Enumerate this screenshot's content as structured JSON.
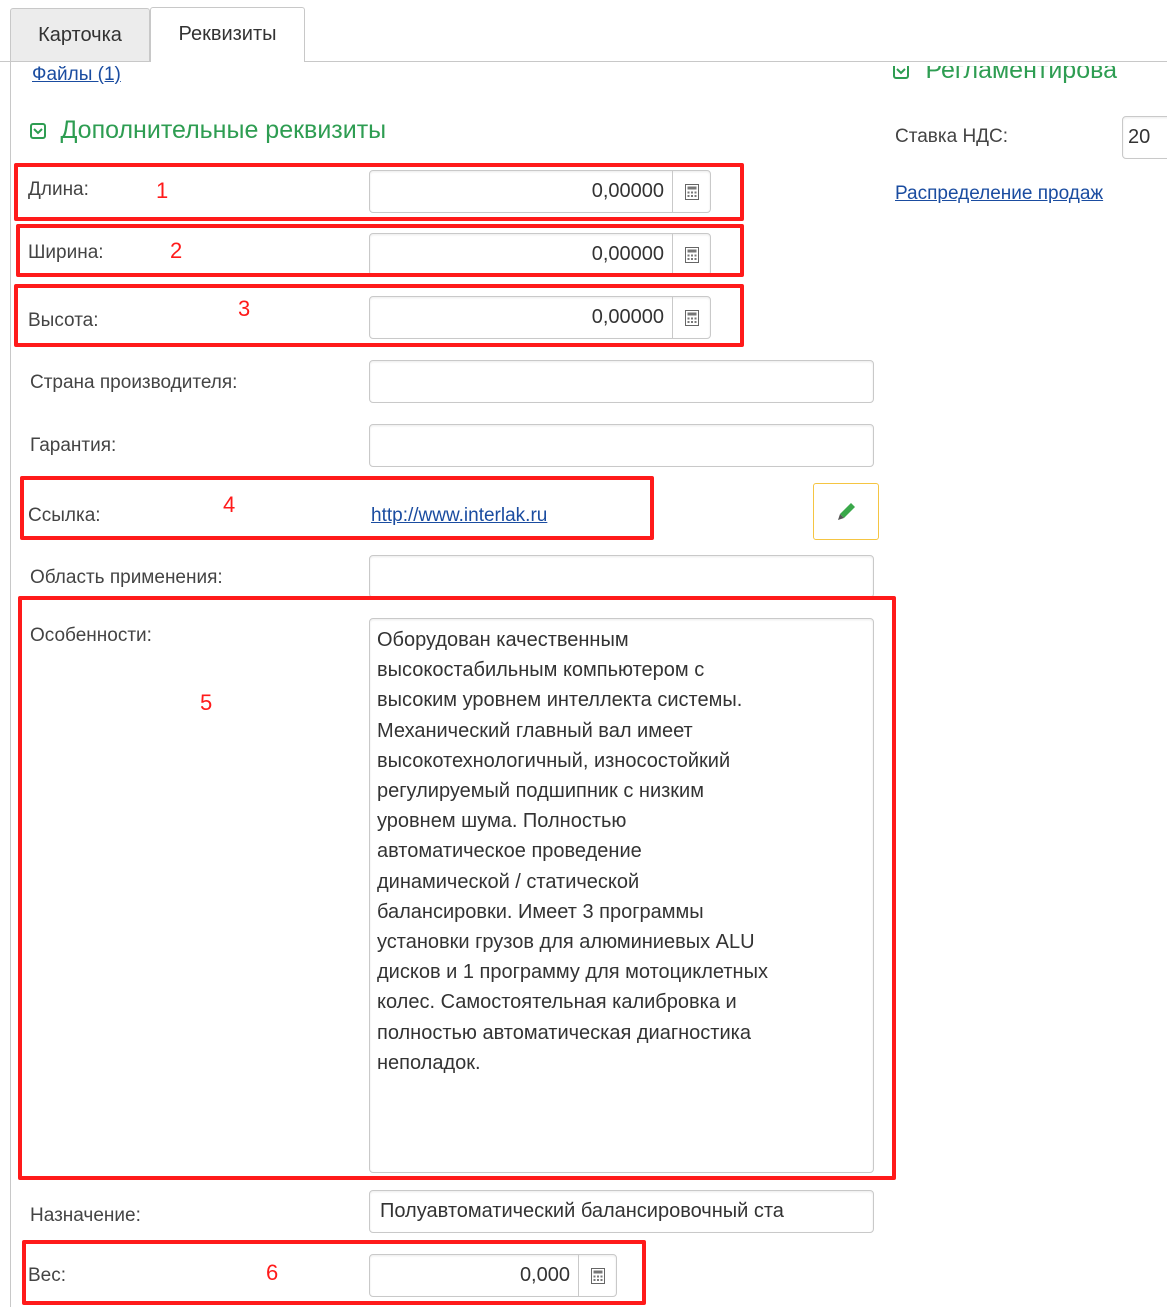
{
  "tabs": [
    {
      "label": "Карточка",
      "active": false
    },
    {
      "label": "Реквизиты",
      "active": true
    }
  ],
  "files_link": "Файлы (1)",
  "additional_section": {
    "title": "Дополнительные реквизиты"
  },
  "right_section": {
    "title": "Регламентирова",
    "vat_label": "Ставка НДС:",
    "vat_value": "20",
    "distribution_link": "Распределение продаж"
  },
  "fields": {
    "length": {
      "label": "Длина:",
      "value": "0,00000"
    },
    "width": {
      "label": "Ширина:",
      "value": "0,00000"
    },
    "height": {
      "label": "Высота:",
      "value": "0,00000"
    },
    "country": {
      "label": "Страна производителя:",
      "value": ""
    },
    "warranty": {
      "label": "Гарантия:",
      "value": ""
    },
    "link": {
      "label": "Ссылка:",
      "value": "http://www.interlak.ru"
    },
    "application": {
      "label": "Область применения:",
      "value": ""
    },
    "features": {
      "label": "Особенности:",
      "value": "Оборудован качественным\nвысокостабильным компьютером с\nвысоким уровнем интеллекта системы.\nМеханический главный вал имеет\nвысокотехнологичный, износостойкий\nрегулируемый подшипник с низким\nуровнем шума.  Полностью\nавтоматическое проведение\nдинамической / статической\nбалансировки.  Имеет 3 программы\nустановки грузов для алюминиевых ALU\nдисков и 1 программу для мотоциклетных\nколес.  Самостоятельная калибровка и\nполностью автоматическая диагностика\nнеполадок."
    },
    "purpose": {
      "label": "Назначение:",
      "value": "Полуавтоматический балансировочный ста"
    },
    "weight": {
      "label": "Вес:",
      "value": "0,000"
    }
  },
  "annotations": [
    "1",
    "2",
    "3",
    "4",
    "5",
    "6"
  ],
  "colors": {
    "accent_green": "#2e9d52",
    "link_blue": "#1a4ca0",
    "annotation_red": "#ff1a1a",
    "edit_border": "#f5c542"
  },
  "icons": {
    "calculator": "calculator-icon",
    "pencil": "pencil-icon",
    "chevron": "chevron-down-icon"
  }
}
